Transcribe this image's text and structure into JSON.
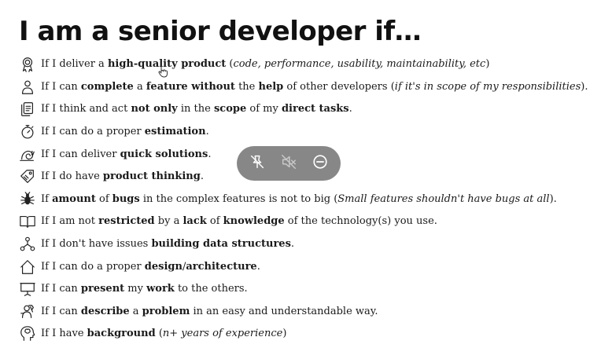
{
  "title": "I am a senior developer if…",
  "rows": [
    {
      "icon": "award-badge-icon",
      "parts": [
        {
          "t": "If I deliver a "
        },
        {
          "t": "high-quality product",
          "s": "b"
        },
        {
          "t": " ("
        },
        {
          "t": "code, performance, usability, maintainability, etc",
          "s": "i"
        },
        {
          "t": ")"
        }
      ]
    },
    {
      "icon": "person-icon",
      "parts": [
        {
          "t": "If I can "
        },
        {
          "t": "complete",
          "s": "b"
        },
        {
          "t": " a "
        },
        {
          "t": "feature without",
          "s": "b"
        },
        {
          "t": " the "
        },
        {
          "t": "help",
          "s": "b"
        },
        {
          "t": " of other developers ("
        },
        {
          "t": "if it's in scope of my responsibilities",
          "s": "i"
        },
        {
          "t": ")."
        }
      ]
    },
    {
      "icon": "documents-icon",
      "parts": [
        {
          "t": "If I think and act "
        },
        {
          "t": "not only",
          "s": "b"
        },
        {
          "t": " in the "
        },
        {
          "t": "scope",
          "s": "b"
        },
        {
          "t": " of my "
        },
        {
          "t": "direct tasks",
          "s": "b"
        },
        {
          "t": "."
        }
      ]
    },
    {
      "icon": "stopwatch-icon",
      "parts": [
        {
          "t": "If I can do a proper "
        },
        {
          "t": "estimation",
          "s": "b"
        },
        {
          "t": "."
        }
      ]
    },
    {
      "icon": "snail-icon",
      "parts": [
        {
          "t": "If I can deliver "
        },
        {
          "t": "quick solutions",
          "s": "b"
        },
        {
          "t": "."
        }
      ]
    },
    {
      "icon": "price-tag-icon",
      "parts": [
        {
          "t": "If I do have "
        },
        {
          "t": "product thinking",
          "s": "b"
        },
        {
          "t": "."
        }
      ]
    },
    {
      "icon": "bug-icon",
      "parts": [
        {
          "t": "If "
        },
        {
          "t": "amount",
          "s": "b"
        },
        {
          "t": " of "
        },
        {
          "t": "bugs",
          "s": "b"
        },
        {
          "t": " in the complex features is not to big ("
        },
        {
          "t": "Small features shouldn't have bugs at all",
          "s": "i"
        },
        {
          "t": ")."
        }
      ]
    },
    {
      "icon": "open-book-icon",
      "parts": [
        {
          "t": "If I am not "
        },
        {
          "t": "restricted",
          "s": "b"
        },
        {
          "t": " by a "
        },
        {
          "t": "lack",
          "s": "b"
        },
        {
          "t": " of "
        },
        {
          "t": "knowledge",
          "s": "b"
        },
        {
          "t": " of the technology(s) you use."
        }
      ]
    },
    {
      "icon": "tree-structure-icon",
      "parts": [
        {
          "t": "If I don't have issues "
        },
        {
          "t": "building data structures",
          "s": "b"
        },
        {
          "t": "."
        }
      ]
    },
    {
      "icon": "house-outline-icon",
      "parts": [
        {
          "t": "If I can do a proper "
        },
        {
          "t": "design",
          "s": "b"
        },
        {
          "t": "/"
        },
        {
          "t": "architecture",
          "s": "b"
        },
        {
          "t": "."
        }
      ]
    },
    {
      "icon": "presentation-board-icon",
      "parts": [
        {
          "t": "If I can "
        },
        {
          "t": "present",
          "s": "b"
        },
        {
          "t": " my "
        },
        {
          "t": "work",
          "s": "b"
        },
        {
          "t": " to the others."
        }
      ]
    },
    {
      "icon": "problem-solving-icon",
      "parts": [
        {
          "t": "If I can "
        },
        {
          "t": "describe",
          "s": "b"
        },
        {
          "t": " a "
        },
        {
          "t": "problem",
          "s": "b"
        },
        {
          "t": " in an easy and understandable way."
        }
      ]
    },
    {
      "icon": "head-brain-icon",
      "parts": [
        {
          "t": "If I have "
        },
        {
          "t": "background",
          "s": "b"
        },
        {
          "t": " ("
        },
        {
          "t": "n+ years of experience",
          "s": "i"
        },
        {
          "t": ")"
        }
      ]
    }
  ],
  "overlay": {
    "buttons": [
      {
        "name": "unpin-button",
        "icon": "pin-off-icon"
      },
      {
        "name": "mute-button",
        "icon": "speaker-muted-icon"
      },
      {
        "name": "minimize-button",
        "icon": "minus-circle-icon"
      }
    ]
  }
}
